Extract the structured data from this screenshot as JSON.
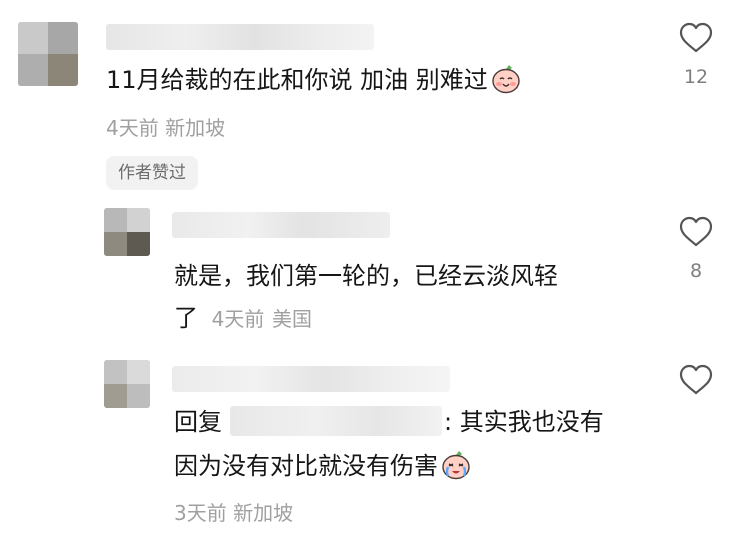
{
  "comments": [
    {
      "text": "11月给裁的在此和你说 加油 别难过",
      "emoji_icon": "peach-smile-face-icon",
      "time": "4天前",
      "location": "新加坡",
      "likes": "12",
      "author_badge": "作者赞过"
    },
    {
      "line1": "就是，我们第一轮的，已经云淡风轻",
      "line2": "了",
      "time": "4天前",
      "location": "美国",
      "likes": "8"
    },
    {
      "reply_prefix": "回复",
      "line1_rest": ": 其实我也没有",
      "line2": "因为没有对比就没有伤害",
      "emoji_icon": "peach-crying-face-icon",
      "time": "3天前",
      "location": "新加坡",
      "likes": ""
    }
  ],
  "icons": {
    "like": "heart-outline-icon"
  },
  "colors": {
    "text": "#161616",
    "meta": "#a0a0a0",
    "count": "#7f7f7f",
    "badge_bg": "#f2f2f2"
  }
}
